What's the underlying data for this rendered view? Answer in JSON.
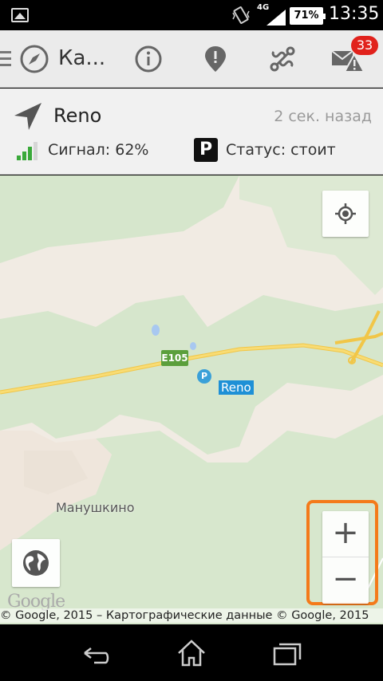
{
  "status_bar": {
    "network": "4G",
    "battery": "71%",
    "time": "13:35"
  },
  "action_bar": {
    "title": "Ка...",
    "badge_count": "33",
    "badge_color": "#e1221c",
    "icons": [
      "menu-icon",
      "compass-icon",
      "info-icon",
      "map-pin-icon",
      "route-icon",
      "mail-alert-icon"
    ]
  },
  "info_panel": {
    "vehicle_name": "Reno",
    "time_ago": "2 сек. назад",
    "signal": "Сигнал: 62%",
    "parking_symbol": "P",
    "status": "Статус: стоит"
  },
  "map": {
    "road_label": "E105",
    "poi_symbol": "P",
    "vehicle_label": "Reno",
    "village_label": "Манушкино",
    "zoom_in": "+",
    "zoom_out": "−",
    "google_logo": "Google",
    "copyright": "© Google, 2015 – Картографические данные © Google, 2015",
    "highlight_color": "#f47a1a"
  }
}
